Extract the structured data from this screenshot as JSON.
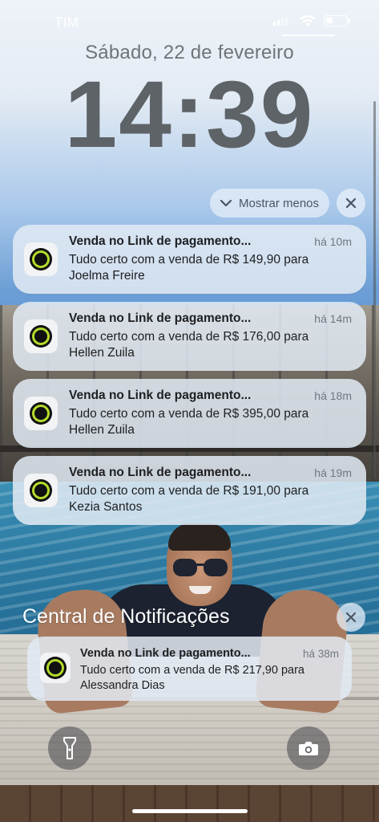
{
  "status_bar": {
    "carrier": "TIM",
    "icons": [
      "cellular-signal-icon",
      "wifi-icon",
      "battery-icon"
    ]
  },
  "lock_screen": {
    "date": "Sábado, 22 de fevereiro",
    "time": "14:39"
  },
  "notification_stack": {
    "show_less_label": "Mostrar menos",
    "close_icon": "close-icon",
    "items": [
      {
        "app_icon": "payment-app-icon",
        "title": "Venda no Link de pagamento...",
        "time": "há 10m",
        "body": "Tudo certo com a venda de R$ 149,90 para Joelma Freire"
      },
      {
        "app_icon": "payment-app-icon",
        "title": "Venda no Link de pagamento...",
        "time": "há 14m",
        "body": "Tudo certo com a venda de R$ 176,00 para Hellen Zuila"
      },
      {
        "app_icon": "payment-app-icon",
        "title": "Venda no Link de pagamento...",
        "time": "há 18m",
        "body": "Tudo certo com a venda de R$ 395,00 para Hellen Zuila"
      },
      {
        "app_icon": "payment-app-icon",
        "title": "Venda no Link de pagamento...",
        "time": "há 19m",
        "body": "Tudo certo com a venda de R$ 191,00 para Kezia Santos"
      }
    ]
  },
  "notification_center": {
    "title": "Central de Notificações",
    "close_icon": "close-icon",
    "items": [
      {
        "app_icon": "payment-app-icon",
        "title": "Venda no Link de pagamento...",
        "time": "há 38m",
        "body": "Tudo certo com a venda de R$ 217,90 para Alessandra Dias"
      }
    ]
  },
  "bottom_controls": {
    "left_icon": "flashlight-icon",
    "right_icon": "camera-icon"
  },
  "colors": {
    "brand_ring": "#b4dc2c",
    "notification_bg": "#e2eaf3",
    "clock_text": "#5e6368"
  }
}
